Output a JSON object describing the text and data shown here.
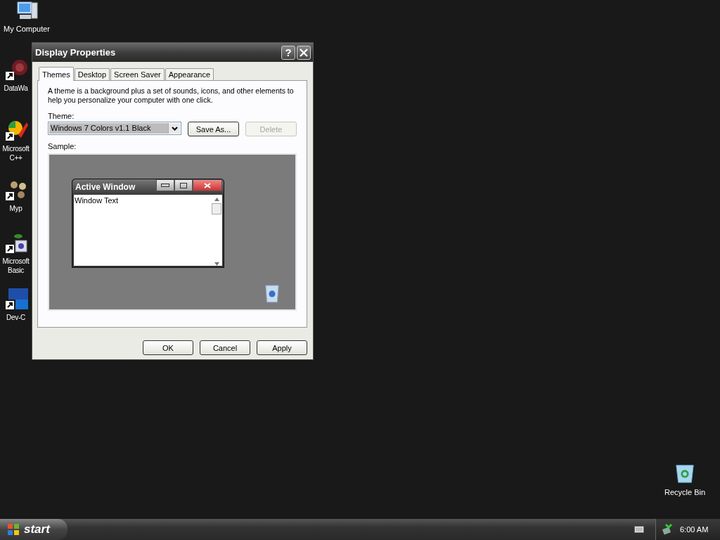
{
  "desktop_icons": [
    {
      "kind": "computer",
      "lines": [
        "My Computer"
      ]
    },
    {
      "kind": "web",
      "lines": [
        "DataWa"
      ]
    },
    {
      "kind": "tools",
      "lines": [
        "Microsoft",
        "C++"
      ]
    },
    {
      "kind": "flowers",
      "lines": [
        "Myp"
      ]
    },
    {
      "kind": "basic",
      "lines": [
        "Microsoft",
        "Basic"
      ]
    },
    {
      "kind": "dev",
      "lines": [
        "Dev-C"
      ]
    }
  ],
  "recycle_bin": {
    "label": "Recycle Bin"
  },
  "window": {
    "title": "Display Properties",
    "help": "?"
  },
  "tabs": [
    {
      "label": "Themes",
      "selected": true
    },
    {
      "label": "Desktop",
      "selected": false
    },
    {
      "label": "Screen Saver",
      "selected": false
    },
    {
      "label": "Appearance",
      "selected": false
    }
  ],
  "description": "A theme is a background plus a set of sounds, icons, and other elements to help you personalize your computer with one click.",
  "theme": {
    "label": "Theme:",
    "value": "Windows 7 Colors v1.1 Black"
  },
  "theme_buttons": [
    {
      "label": "Save As...",
      "disabled": false
    },
    {
      "label": "Delete",
      "disabled": true
    }
  ],
  "sample": {
    "label": "Sample:",
    "window_title": "Active Window",
    "window_text": "Window Text"
  },
  "buttons": [
    "OK",
    "Cancel",
    "Apply"
  ],
  "taskbar": {
    "start": "start",
    "clock": "6:00 AM"
  }
}
